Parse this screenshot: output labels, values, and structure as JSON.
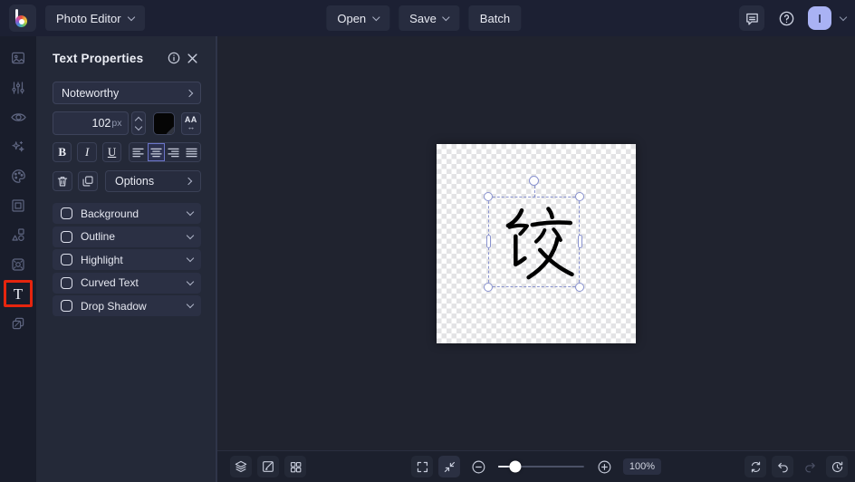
{
  "topbar": {
    "app_menu_label": "Photo Editor",
    "open_label": "Open",
    "save_label": "Save",
    "batch_label": "Batch",
    "avatar_initial": "I"
  },
  "sidebar": {
    "tools": [
      {
        "icon": "image-icon"
      },
      {
        "icon": "adjust-sliders-icon"
      },
      {
        "icon": "touchup-eye-icon"
      },
      {
        "icon": "effects-sparkles-icon"
      },
      {
        "icon": "artsy-palette-icon"
      },
      {
        "icon": "frames-icon"
      },
      {
        "icon": "graphics-shapes-icon"
      },
      {
        "icon": "textures-icon"
      },
      {
        "icon": "text-tool-icon",
        "active": true,
        "glyph": "T"
      },
      {
        "icon": "layers-copy-icon"
      }
    ],
    "active_tool_highlight_color": "#e6250e"
  },
  "panel": {
    "title": "Text Properties",
    "font_family": "Noteworthy",
    "font_size": "102",
    "font_size_unit": "px",
    "text_color_swatch": "#000000",
    "bold_label": "B",
    "italic_label": "I",
    "underline_label": "U",
    "letter_spacing_glyph": "AA",
    "letter_spacing_arrow": "↔",
    "active_alignment": "center",
    "options_label": "Options",
    "toggles": [
      {
        "label": "Background",
        "checked": false
      },
      {
        "label": "Outline",
        "checked": false
      },
      {
        "label": "Highlight",
        "checked": false
      },
      {
        "label": "Curved Text",
        "checked": false
      },
      {
        "label": "Drop Shadow",
        "checked": false
      }
    ]
  },
  "canvas": {
    "text_content": "饺",
    "text_color": "#000000",
    "selection_handle_color": "#8a93cf"
  },
  "bottombar": {
    "zoom_level": "100%"
  },
  "colors": {
    "accent": "#6b75c9",
    "tool_highlight_red": "#e6250e",
    "avatar_bg": "#a9b2f4"
  }
}
